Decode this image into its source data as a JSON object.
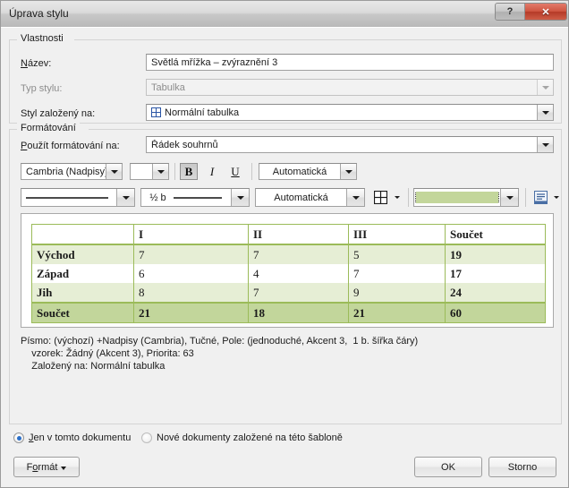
{
  "window": {
    "title": "Úprava stylu",
    "help_button": "?",
    "close_button": "✕"
  },
  "properties_group": {
    "legend": "Vlastnosti",
    "name_label": "Název:",
    "name_value": "Světlá mřížka – zvýraznění 3",
    "style_type_label": "Typ stylu:",
    "style_type_value": "Tabulka",
    "based_on_label": "Styl založený na:",
    "based_on_value": "Normální tabulka"
  },
  "formatting_group": {
    "legend": "Formátování",
    "apply_to_label": "Použít formátování na:",
    "apply_to_value": "Řádek souhrnů",
    "font_name": "Cambria (Nadpisy)",
    "font_size": "",
    "bold_label": "B",
    "italic_label": "I",
    "underline_label": "U",
    "font_color": "Automatická",
    "border_style_value": "",
    "border_width_value": "½ b",
    "border_color": "Automatická",
    "shading_color_hex": "#c3d69b"
  },
  "preview_table": {
    "columns": [
      "",
      "I",
      "II",
      "III",
      "Součet"
    ],
    "rows": [
      {
        "label": "Východ",
        "values": [
          "7",
          "7",
          "5",
          "19"
        ],
        "banded": true
      },
      {
        "label": "Západ",
        "values": [
          "6",
          "4",
          "7",
          "17"
        ],
        "banded": false
      },
      {
        "label": "Jih",
        "values": [
          "8",
          "7",
          "9",
          "24"
        ],
        "banded": true
      }
    ],
    "footer": {
      "label": "Součet",
      "values": [
        "21",
        "18",
        "21",
        "60"
      ]
    }
  },
  "description": {
    "line1": "Písmo: (výchozí) +Nadpisy (Cambria), Tučné, Pole: (jednoduché, Akcent 3,  1 b. šířka čáry)",
    "line2": "    vzorek: Žádný (Akcent 3), Priorita: 63",
    "line3": "    Založený na: Normální tabulka"
  },
  "scope": {
    "option_this_document": "Jen v tomto dokumentu",
    "option_new_documents": "Nové dokumenty založené na této šabloně",
    "selected": "this_document"
  },
  "footer": {
    "format_button": "Formát",
    "ok_button": "OK",
    "cancel_button": "Storno"
  }
}
